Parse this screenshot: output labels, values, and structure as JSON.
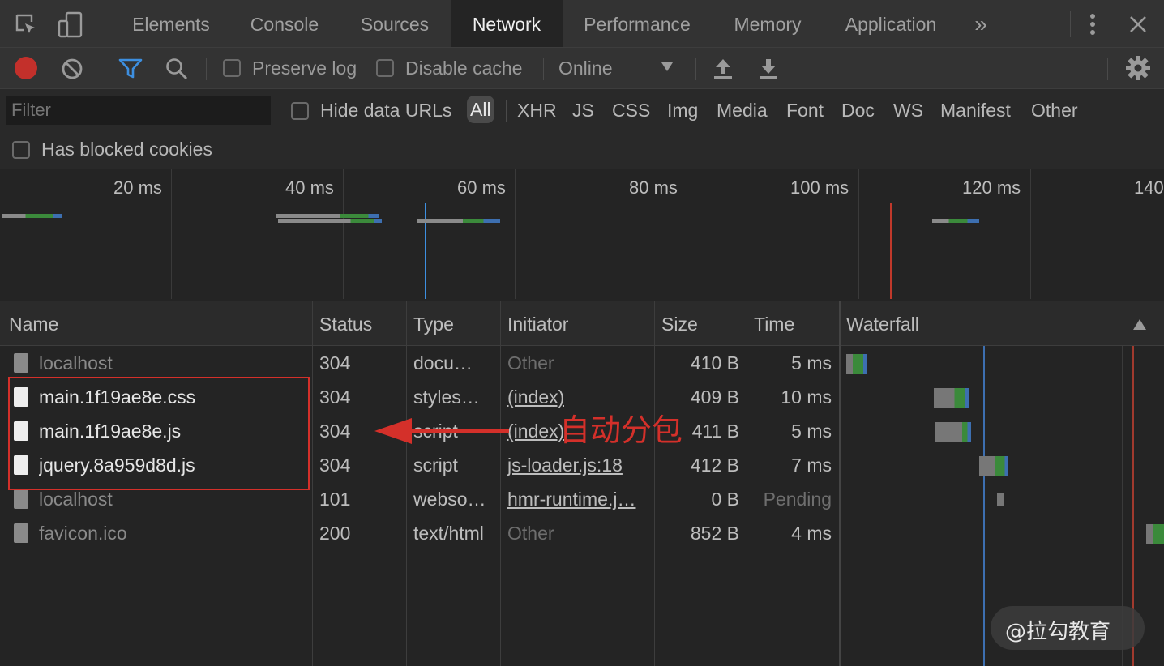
{
  "tabs": [
    "Elements",
    "Console",
    "Sources",
    "Network",
    "Performance",
    "Memory",
    "Application"
  ],
  "active_tab": "Network",
  "more_tabs_glyph": "»",
  "toolbar": {
    "preserve_log": "Preserve log",
    "disable_cache": "Disable cache",
    "throttle": "Online"
  },
  "filter": {
    "placeholder": "Filter",
    "hide_data_urls": "Hide data URLs",
    "types": [
      "All",
      "XHR",
      "JS",
      "CSS",
      "Img",
      "Media",
      "Font",
      "Doc",
      "WS",
      "Manifest",
      "Other"
    ],
    "selected_type": "All",
    "has_blocked_cookies": "Has blocked cookies"
  },
  "overview_ticks": [
    "20 ms",
    "40 ms",
    "60 ms",
    "80 ms",
    "100 ms",
    "120 ms",
    "140"
  ],
  "columns": [
    "Name",
    "Status",
    "Type",
    "Initiator",
    "Size",
    "Time",
    "Waterfall"
  ],
  "rows": [
    {
      "name": "localhost",
      "status": "304",
      "type": "docu…",
      "initiator": "Other",
      "size": "410 B",
      "time": "5 ms"
    },
    {
      "name": "main.1f19ae8e.css",
      "status": "304",
      "type": "styles…",
      "initiator": "(index)",
      "size": "409 B",
      "time": "10 ms"
    },
    {
      "name": "main.1f19ae8e.js",
      "status": "304",
      "type": "script",
      "initiator": "(index)",
      "size": "411 B",
      "time": "5 ms"
    },
    {
      "name": "jquery.8a959d8d.js",
      "status": "304",
      "type": "script",
      "initiator": "js-loader.js:18",
      "size": "412 B",
      "time": "7 ms"
    },
    {
      "name": "localhost",
      "status": "101",
      "type": "webso…",
      "initiator": "hmr-runtime.j…",
      "size": "0 B",
      "time": "Pending"
    },
    {
      "name": "favicon.ico",
      "status": "200",
      "type": "text/html",
      "initiator": "Other",
      "size": "852 B",
      "time": "4 ms"
    }
  ],
  "annotation": "自动分包",
  "watermark": "@拉勾教育",
  "colors": {
    "accent_blue": "#3d8fe0",
    "record_red": "#c3302b",
    "annotation_red": "#d4302a",
    "active_tab_bg": "#242424"
  }
}
